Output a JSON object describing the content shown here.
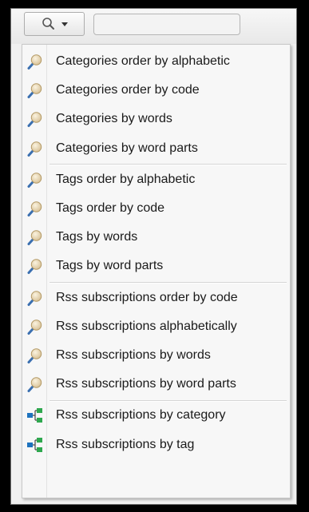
{
  "toolbar": {
    "search_icon": "magnifier-icon",
    "dropdown_icon": "caret-down-icon",
    "search_value": ""
  },
  "menu": {
    "groups": [
      {
        "items": [
          {
            "label": "Categories order by alphabetic",
            "icon": "magnifier-icon"
          },
          {
            "label": "Categories order by code",
            "icon": "magnifier-icon"
          },
          {
            "label": "Categories by words",
            "icon": "magnifier-icon"
          },
          {
            "label": "Categories by word parts",
            "icon": "magnifier-icon"
          }
        ]
      },
      {
        "items": [
          {
            "label": "Tags order by alphabetic",
            "icon": "magnifier-icon"
          },
          {
            "label": "Tags order by code",
            "icon": "magnifier-icon"
          },
          {
            "label": "Tags by words",
            "icon": "magnifier-icon"
          },
          {
            "label": "Tags by word parts",
            "icon": "magnifier-icon"
          }
        ]
      },
      {
        "items": [
          {
            "label": "Rss subscriptions order by code",
            "icon": "magnifier-icon"
          },
          {
            "label": "Rss subscriptions alphabetically",
            "icon": "magnifier-icon"
          },
          {
            "label": "Rss subscriptions by words",
            "icon": "magnifier-icon"
          },
          {
            "label": "Rss subscriptions by word parts",
            "icon": "magnifier-icon"
          }
        ]
      },
      {
        "items": [
          {
            "label": "Rss subscriptions by category",
            "icon": "tree-icon"
          },
          {
            "label": "Rss subscriptions by tag",
            "icon": "tree-icon"
          }
        ]
      }
    ]
  },
  "colors": {
    "magnifier_lens": "#d9c39a",
    "magnifier_handle": "#3a6fb0",
    "tree_green": "#2fa84f",
    "tree_blue": "#1e73be"
  }
}
